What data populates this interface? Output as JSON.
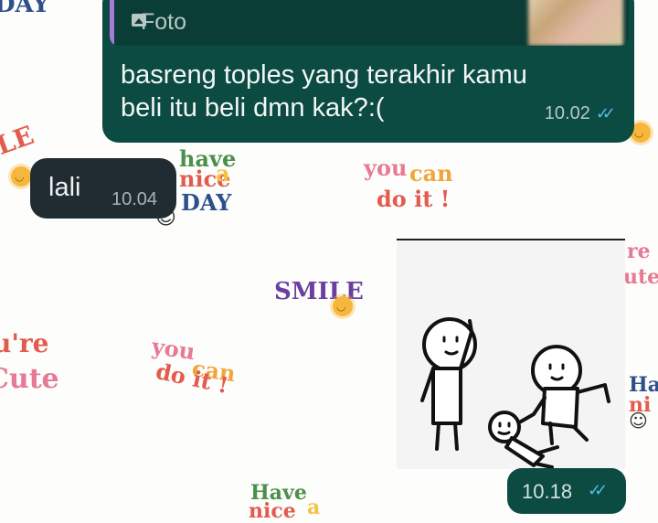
{
  "chat": {
    "outgoing_message": {
      "reply_quote": {
        "label": "Foto",
        "icon": "image-icon",
        "bar_color": "#a77ad8"
      },
      "text_line1": "basreng toples yang terakhir kamu",
      "text_line2": "beli itu beli dmn kak?:(",
      "time": "10.02",
      "status": "read"
    },
    "incoming_message": {
      "text": "lali",
      "time": "10.04"
    },
    "sticker_message": {
      "time": "10.18",
      "status": "read"
    }
  },
  "wallpaper": {
    "doodles": {
      "day_top": "DAY",
      "have": "have",
      "nice": "nice",
      "a": "a",
      "day": "DAY",
      "you1": "you",
      "can1": "can",
      "doit1": "do it !",
      "smile": "SMILE",
      "youre": "u're",
      "cute": "Cute",
      "you2": "you",
      "can2": "can",
      "doit2": "do it !",
      "re_right": "re",
      "ute_right": "ute",
      "ha_right": "Ha",
      "ni_right": "ni",
      "have2": "Have",
      "nice2": "nice",
      "a2": "a",
      "le_left": "LE"
    }
  },
  "colors": {
    "outgoing_bubble": "#0b4b42",
    "incoming_bubble": "#202c31",
    "read_ticks": "#53bdeb",
    "wallpaper": "#fdfdfb"
  }
}
